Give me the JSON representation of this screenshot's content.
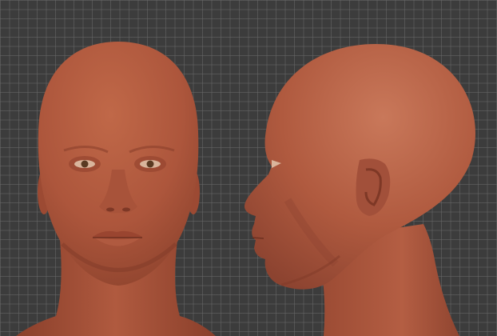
{
  "viewport": {
    "background_color": "#3c3c3c",
    "grid_color": "#696969"
  },
  "models": [
    {
      "view": "front",
      "skin_color": "#b35a3f",
      "shadow_color": "#8a3e2a",
      "highlight_color": "#c97458"
    },
    {
      "view": "side",
      "skin_color": "#b35a3f",
      "shadow_color": "#8a3e2a",
      "highlight_color": "#c97458"
    }
  ],
  "eye_color": "#5a3a22"
}
